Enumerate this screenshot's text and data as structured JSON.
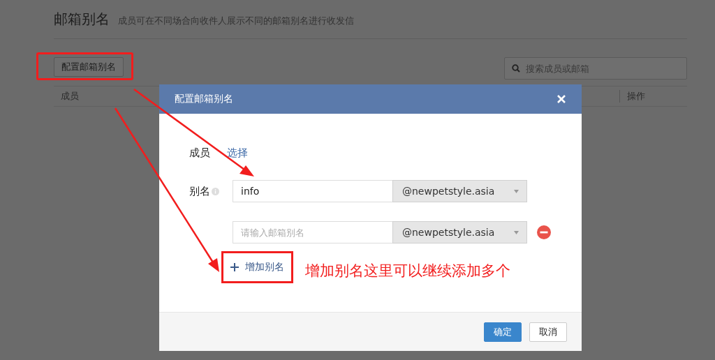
{
  "page": {
    "title": "邮箱别名",
    "subtitle": "成员可在不同场合向收件人展示不同的邮箱别名进行收发信",
    "config_button": "配置邮箱别名",
    "search": {
      "placeholder": "搜索成员或邮箱"
    },
    "table": {
      "columns": [
        "成员",
        "操作"
      ]
    }
  },
  "dialog": {
    "title": "配置邮箱别名",
    "member_label": "成员",
    "member_link": "选择",
    "alias_label": "别名",
    "aliases": [
      {
        "value": "info",
        "domain": "@newpetstyle.asia",
        "removable": false
      },
      {
        "placeholder": "请输入邮箱别名",
        "domain": "@newpetstyle.asia",
        "removable": true
      }
    ],
    "add_button": "增加别名",
    "buttons": [
      {
        "label": "确定",
        "kind": "primary"
      },
      {
        "label": "取消",
        "kind": "default"
      }
    ]
  },
  "annotation": {
    "text": "增加别名这里可以继续添加多个"
  }
}
